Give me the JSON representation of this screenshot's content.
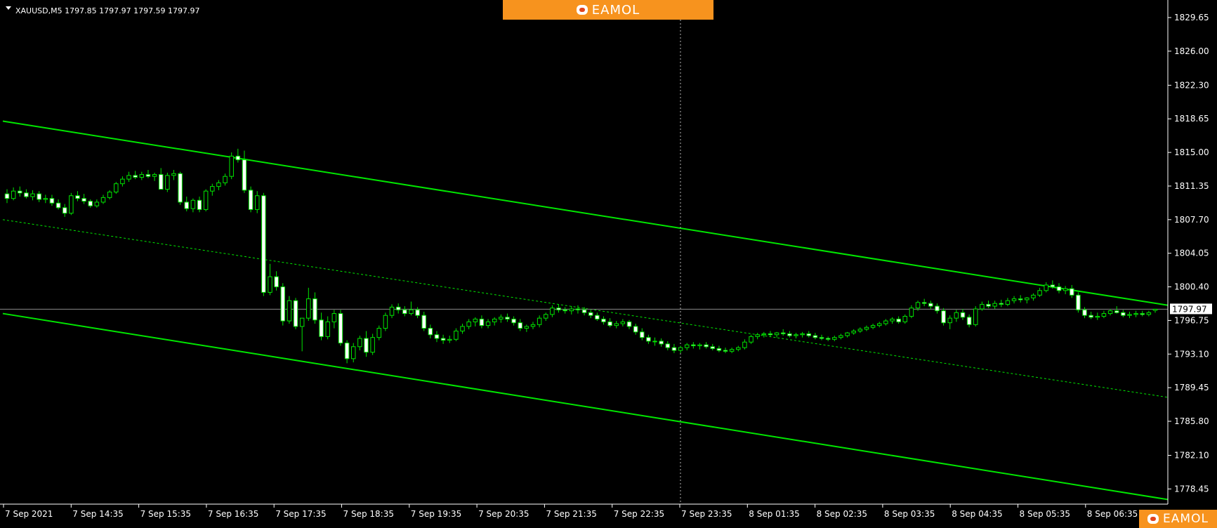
{
  "header": {
    "symbol_info": "XAUUSD,M5  1797.85 1797.97 1797.59 1797.97"
  },
  "watermarks": {
    "top": "EAMOL",
    "bottom": "EAMOL"
  },
  "colors": {
    "background": "#000000",
    "channel": "#00e600",
    "candle_up_body": "#000000",
    "candle_down_body": "#ffffff",
    "candle_outline": "#00e600",
    "axis": "#ffffff",
    "bid_line": "#8a8a8a",
    "crosshair": "#b5b5b5",
    "banner": "#f7931e"
  },
  "chart_data": {
    "type": "candlestick",
    "symbol": "XAUUSD",
    "timeframe": "M5",
    "ohlc_header": [
      1797.85,
      1797.97,
      1797.59,
      1797.97
    ],
    "current_price_label": "1797.97",
    "current_price": 1797.97,
    "ylim": [
      1776.8,
      1831.1
    ],
    "y_ticks": [
      "1829.65",
      "1826.00",
      "1822.30",
      "1818.65",
      "1815.00",
      "1811.35",
      "1807.70",
      "1804.05",
      "1800.40",
      "1796.75",
      "1793.10",
      "1789.45",
      "1785.80",
      "1782.10",
      "1778.45"
    ],
    "x_ticks": [
      "7 Sep 2021",
      "7 Sep 14:35",
      "7 Sep 15:35",
      "7 Sep 16:35",
      "7 Sep 17:35",
      "7 Sep 18:35",
      "7 Sep 19:35",
      "7 Sep 20:35",
      "7 Sep 21:35",
      "7 Sep 22:35",
      "7 Sep 23:35",
      "8 Sep 01:35",
      "8 Sep 02:35",
      "8 Sep 03:35",
      "8 Sep 04:35",
      "8 Sep 05:35",
      "8 Sep 06:35"
    ],
    "crosshair_x_label": "7 Sep 23:35",
    "channel": {
      "upper": [
        1818.4,
        1798.4
      ],
      "middle": [
        1807.7,
        1788.4
      ],
      "lower": [
        1797.5,
        1777.3
      ],
      "x_span": [
        "7 Sep 2021",
        "8 Sep 06:35"
      ]
    },
    "candles": [
      [
        1810.5,
        1811.0,
        1809.5,
        1810.0
      ],
      [
        1810.0,
        1811.2,
        1809.8,
        1810.8
      ],
      [
        1810.8,
        1811.3,
        1810.2,
        1810.6
      ],
      [
        1810.6,
        1811.0,
        1810.0,
        1810.2
      ],
      [
        1810.2,
        1810.9,
        1809.8,
        1810.5
      ],
      [
        1810.5,
        1810.8,
        1809.6,
        1809.9
      ],
      [
        1809.9,
        1810.4,
        1809.5,
        1810.0
      ],
      [
        1810.0,
        1810.4,
        1809.2,
        1809.5
      ],
      [
        1809.5,
        1809.9,
        1808.8,
        1809.0
      ],
      [
        1809.0,
        1809.4,
        1808.0,
        1808.4
      ],
      [
        1808.4,
        1810.6,
        1808.2,
        1810.3
      ],
      [
        1810.3,
        1810.8,
        1809.7,
        1810.0
      ],
      [
        1810.0,
        1810.5,
        1809.4,
        1809.7
      ],
      [
        1809.7,
        1809.9,
        1809.0,
        1809.2
      ],
      [
        1809.2,
        1809.9,
        1809.0,
        1809.6
      ],
      [
        1809.6,
        1810.4,
        1809.4,
        1810.1
      ],
      [
        1810.1,
        1810.9,
        1809.9,
        1810.7
      ],
      [
        1810.7,
        1811.8,
        1810.5,
        1811.6
      ],
      [
        1811.6,
        1812.4,
        1811.3,
        1812.1
      ],
      [
        1812.1,
        1812.9,
        1811.8,
        1812.5
      ],
      [
        1812.5,
        1813.0,
        1812.1,
        1812.3
      ],
      [
        1812.3,
        1812.9,
        1812.0,
        1812.6
      ],
      [
        1812.6,
        1813.1,
        1812.2,
        1812.4
      ],
      [
        1812.4,
        1812.8,
        1811.9,
        1812.6
      ],
      [
        1812.6,
        1813.3,
        1812.3,
        1811.0
      ],
      [
        1811.0,
        1812.8,
        1810.7,
        1812.5
      ],
      [
        1812.5,
        1813.1,
        1812.0,
        1812.7
      ],
      [
        1812.7,
        1812.9,
        1809.3,
        1809.6
      ],
      [
        1809.6,
        1810.2,
        1808.6,
        1808.9
      ],
      [
        1808.9,
        1810.0,
        1808.5,
        1809.8
      ],
      [
        1809.8,
        1810.2,
        1808.5,
        1808.8
      ],
      [
        1808.8,
        1811.0,
        1808.6,
        1810.8
      ],
      [
        1810.8,
        1811.6,
        1810.3,
        1811.3
      ],
      [
        1811.3,
        1812.0,
        1810.9,
        1811.7
      ],
      [
        1811.7,
        1812.7,
        1811.4,
        1812.4
      ],
      [
        1812.4,
        1815.0,
        1812.1,
        1814.6
      ],
      [
        1814.6,
        1815.4,
        1813.9,
        1814.2
      ],
      [
        1814.2,
        1815.2,
        1810.6,
        1810.9
      ],
      [
        1810.9,
        1811.3,
        1808.5,
        1808.8
      ],
      [
        1808.8,
        1810.8,
        1808.4,
        1810.3
      ],
      [
        1810.3,
        1810.6,
        1799.4,
        1799.8
      ],
      [
        1799.8,
        1802.9,
        1799.5,
        1801.5
      ],
      [
        1801.5,
        1802.1,
        1800.0,
        1800.4
      ],
      [
        1800.4,
        1800.8,
        1796.2,
        1796.7
      ],
      [
        1796.7,
        1799.4,
        1796.4,
        1798.9
      ],
      [
        1798.9,
        1799.2,
        1795.8,
        1796.1
      ],
      [
        1796.1,
        1796.8,
        1793.4,
        1797.0
      ],
      [
        1797.0,
        1800.3,
        1796.7,
        1799.1
      ],
      [
        1799.1,
        1799.8,
        1796.4,
        1796.8
      ],
      [
        1796.8,
        1797.6,
        1794.6,
        1795.0
      ],
      [
        1795.0,
        1797.2,
        1794.7,
        1796.6
      ],
      [
        1796.6,
        1797.9,
        1795.9,
        1797.5
      ],
      [
        1797.5,
        1797.9,
        1794.0,
        1794.3
      ],
      [
        1794.3,
        1794.6,
        1792.1,
        1792.6
      ],
      [
        1792.6,
        1794.3,
        1792.2,
        1793.9
      ],
      [
        1793.9,
        1795.1,
        1793.5,
        1794.8
      ],
      [
        1794.8,
        1795.6,
        1792.8,
        1793.3
      ],
      [
        1793.3,
        1795.3,
        1793.0,
        1794.9
      ],
      [
        1794.9,
        1796.2,
        1794.6,
        1795.9
      ],
      [
        1795.9,
        1797.6,
        1795.6,
        1797.3
      ],
      [
        1797.3,
        1798.5,
        1797.0,
        1798.2
      ],
      [
        1798.2,
        1798.6,
        1797.5,
        1797.9
      ],
      [
        1797.9,
        1798.3,
        1797.2,
        1797.5
      ],
      [
        1797.5,
        1798.8,
        1797.3,
        1797.9
      ],
      [
        1797.9,
        1798.2,
        1797.0,
        1797.3
      ],
      [
        1797.3,
        1797.7,
        1795.6,
        1795.9
      ],
      [
        1795.9,
        1796.3,
        1794.8,
        1795.2
      ],
      [
        1795.2,
        1795.6,
        1794.4,
        1794.8
      ],
      [
        1794.8,
        1795.2,
        1794.2,
        1794.6
      ],
      [
        1794.6,
        1795.1,
        1794.3,
        1794.7
      ],
      [
        1794.7,
        1795.9,
        1794.5,
        1795.6
      ],
      [
        1795.6,
        1796.4,
        1795.3,
        1796.1
      ],
      [
        1796.1,
        1796.9,
        1795.8,
        1796.6
      ],
      [
        1796.6,
        1797.1,
        1796.1,
        1796.9
      ],
      [
        1796.9,
        1797.3,
        1795.9,
        1796.2
      ],
      [
        1796.2,
        1796.9,
        1795.9,
        1796.6
      ],
      [
        1796.6,
        1797.1,
        1796.2,
        1796.9
      ],
      [
        1796.9,
        1797.4,
        1796.5,
        1797.1
      ],
      [
        1797.1,
        1797.5,
        1796.6,
        1796.9
      ],
      [
        1796.9,
        1797.2,
        1796.2,
        1796.5
      ],
      [
        1796.5,
        1796.9,
        1795.6,
        1795.9
      ],
      [
        1795.9,
        1796.3,
        1795.5,
        1796.1
      ],
      [
        1796.1,
        1796.6,
        1795.8,
        1796.3
      ],
      [
        1796.3,
        1797.3,
        1796.0,
        1797.0
      ],
      [
        1797.0,
        1797.6,
        1796.7,
        1797.4
      ],
      [
        1797.4,
        1798.4,
        1797.1,
        1798.1
      ],
      [
        1798.1,
        1798.5,
        1797.6,
        1797.9
      ],
      [
        1797.9,
        1798.2,
        1797.5,
        1797.8
      ],
      [
        1797.8,
        1798.3,
        1797.4,
        1798.0
      ],
      [
        1798.0,
        1798.4,
        1797.5,
        1797.9
      ],
      [
        1797.9,
        1798.2,
        1797.3,
        1797.6
      ],
      [
        1797.6,
        1797.9,
        1797.0,
        1797.3
      ],
      [
        1797.3,
        1797.6,
        1796.7,
        1796.9
      ],
      [
        1796.9,
        1797.2,
        1796.3,
        1796.6
      ],
      [
        1796.6,
        1797.0,
        1796.0,
        1796.2
      ],
      [
        1796.2,
        1796.7,
        1795.9,
        1796.4
      ],
      [
        1796.4,
        1796.9,
        1796.1,
        1796.6
      ],
      [
        1796.6,
        1796.8,
        1795.8,
        1796.1
      ],
      [
        1796.1,
        1796.4,
        1795.2,
        1795.5
      ],
      [
        1795.5,
        1795.9,
        1794.6,
        1794.9
      ],
      [
        1794.9,
        1795.2,
        1794.2,
        1794.5
      ],
      [
        1794.5,
        1794.9,
        1794.0,
        1794.5
      ],
      [
        1794.5,
        1794.8,
        1793.9,
        1794.2
      ],
      [
        1794.2,
        1794.5,
        1793.5,
        1793.8
      ],
      [
        1793.8,
        1794.2,
        1793.2,
        1793.5
      ],
      [
        1793.5,
        1794.0,
        1793.2,
        1793.8
      ],
      [
        1793.8,
        1794.3,
        1793.5,
        1794.1
      ],
      [
        1794.1,
        1794.4,
        1793.7,
        1794.0
      ],
      [
        1794.0,
        1794.3,
        1793.6,
        1794.1
      ],
      [
        1794.1,
        1794.4,
        1793.7,
        1793.9
      ],
      [
        1793.9,
        1794.2,
        1793.5,
        1793.7
      ],
      [
        1793.7,
        1794.0,
        1793.3,
        1793.5
      ],
      [
        1793.5,
        1793.8,
        1793.2,
        1793.4
      ],
      [
        1793.4,
        1793.8,
        1793.2,
        1793.6
      ],
      [
        1793.6,
        1794.0,
        1793.4,
        1793.8
      ],
      [
        1793.8,
        1794.7,
        1793.6,
        1794.4
      ],
      [
        1794.4,
        1795.2,
        1794.2,
        1795.0
      ],
      [
        1795.0,
        1795.4,
        1794.7,
        1795.2
      ],
      [
        1795.2,
        1795.5,
        1794.9,
        1795.3
      ],
      [
        1795.3,
        1795.6,
        1795.0,
        1795.2
      ],
      [
        1795.2,
        1795.5,
        1794.9,
        1795.4
      ],
      [
        1795.4,
        1795.8,
        1795.1,
        1795.3
      ],
      [
        1795.3,
        1795.6,
        1794.9,
        1795.1
      ],
      [
        1795.1,
        1795.4,
        1794.8,
        1795.2
      ],
      [
        1795.2,
        1795.5,
        1794.9,
        1795.3
      ],
      [
        1795.3,
        1795.6,
        1794.9,
        1795.1
      ],
      [
        1795.1,
        1795.4,
        1794.7,
        1794.9
      ],
      [
        1794.9,
        1795.2,
        1794.6,
        1794.8
      ],
      [
        1794.8,
        1795.0,
        1794.5,
        1794.7
      ],
      [
        1794.7,
        1795.1,
        1794.5,
        1794.9
      ],
      [
        1794.9,
        1795.3,
        1794.7,
        1795.1
      ],
      [
        1795.1,
        1795.5,
        1794.9,
        1795.4
      ],
      [
        1795.4,
        1795.8,
        1795.2,
        1795.6
      ],
      [
        1795.6,
        1796.0,
        1795.4,
        1795.8
      ],
      [
        1795.8,
        1796.2,
        1795.6,
        1796.0
      ],
      [
        1796.0,
        1796.4,
        1795.8,
        1796.2
      ],
      [
        1796.2,
        1796.6,
        1796.0,
        1796.4
      ],
      [
        1796.4,
        1796.9,
        1796.2,
        1796.7
      ],
      [
        1796.7,
        1797.1,
        1796.4,
        1796.9
      ],
      [
        1796.9,
        1797.2,
        1796.4,
        1796.6
      ],
      [
        1796.6,
        1797.4,
        1796.4,
        1797.2
      ],
      [
        1797.2,
        1798.4,
        1797.0,
        1798.1
      ],
      [
        1798.1,
        1798.9,
        1797.8,
        1798.7
      ],
      [
        1798.7,
        1799.1,
        1798.3,
        1798.6
      ],
      [
        1798.6,
        1798.9,
        1798.0,
        1798.3
      ],
      [
        1798.3,
        1798.6,
        1797.5,
        1797.8
      ],
      [
        1797.8,
        1798.1,
        1796.2,
        1796.5
      ],
      [
        1796.5,
        1797.3,
        1795.8,
        1797.0
      ],
      [
        1797.0,
        1797.9,
        1796.6,
        1797.6
      ],
      [
        1797.6,
        1798.0,
        1796.8,
        1797.1
      ],
      [
        1797.1,
        1797.4,
        1796.0,
        1796.3
      ],
      [
        1796.3,
        1798.3,
        1796.1,
        1798.0
      ],
      [
        1798.0,
        1798.8,
        1797.8,
        1798.5
      ],
      [
        1798.5,
        1798.9,
        1798.1,
        1798.3
      ],
      [
        1798.3,
        1798.9,
        1798.0,
        1798.6
      ],
      [
        1798.6,
        1799.0,
        1798.2,
        1798.5
      ],
      [
        1798.5,
        1799.2,
        1798.3,
        1798.9
      ],
      [
        1798.9,
        1799.4,
        1798.6,
        1799.1
      ],
      [
        1799.1,
        1799.5,
        1798.7,
        1799.0
      ],
      [
        1799.0,
        1799.3,
        1798.6,
        1799.2
      ],
      [
        1799.2,
        1799.7,
        1798.9,
        1799.5
      ],
      [
        1799.5,
        1800.3,
        1799.3,
        1800.0
      ],
      [
        1800.0,
        1800.9,
        1799.8,
        1800.6
      ],
      [
        1800.6,
        1801.1,
        1800.2,
        1800.4
      ],
      [
        1800.4,
        1800.8,
        1799.7,
        1800.0
      ],
      [
        1800.0,
        1800.5,
        1799.6,
        1800.2
      ],
      [
        1800.2,
        1800.6,
        1799.2,
        1799.5
      ],
      [
        1799.5,
        1799.8,
        1797.6,
        1797.9
      ],
      [
        1797.9,
        1798.2,
        1797.0,
        1797.3
      ],
      [
        1797.3,
        1797.7,
        1796.9,
        1797.1
      ],
      [
        1797.1,
        1797.6,
        1796.8,
        1797.2
      ],
      [
        1797.2,
        1797.8,
        1797.0,
        1797.5
      ],
      [
        1797.5,
        1798.0,
        1797.3,
        1797.8
      ],
      [
        1797.8,
        1798.3,
        1797.5,
        1797.6
      ],
      [
        1797.6,
        1797.9,
        1797.1,
        1797.3
      ],
      [
        1797.3,
        1797.7,
        1797.0,
        1797.4
      ],
      [
        1797.4,
        1797.8,
        1797.1,
        1797.5
      ],
      [
        1797.5,
        1797.8,
        1797.2,
        1797.4
      ],
      [
        1797.4,
        1797.8,
        1797.2,
        1797.6
      ],
      [
        1797.85,
        1797.97,
        1797.59,
        1797.97
      ]
    ]
  }
}
